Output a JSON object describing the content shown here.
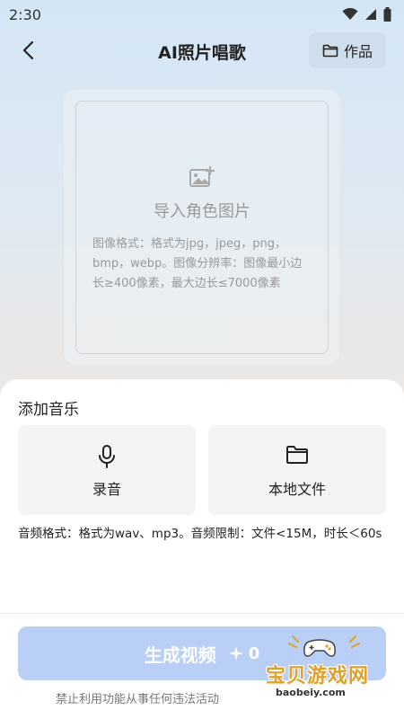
{
  "status_bar": {
    "time": "2:30"
  },
  "header": {
    "title": "AI照片唱歌",
    "works_label": "作品"
  },
  "upload": {
    "title": "导入角色图片",
    "description": "图像格式：格式为jpg，jpeg，png，bmp，webp。图像分辨率：图像最小边长≥400像素，最大边长≤7000像素"
  },
  "music_sheet": {
    "title": "添加音乐",
    "options": [
      {
        "label": "录音",
        "icon": "microphone-icon"
      },
      {
        "label": "本地文件",
        "icon": "folder-icon"
      }
    ],
    "format_note": "音频格式：格式为wav、mp3。音频限制：文件<15M，时长＜60s"
  },
  "generate": {
    "label": "生成视频",
    "cost": "0",
    "cost_icon": "sparkle-icon"
  },
  "disclaimer": "禁止利用功能从事任何违法活动",
  "watermark": {
    "text": "宝贝游戏网",
    "url": "baobeiy.com"
  },
  "colors": {
    "generate_button": "#b9cff5",
    "works_button": "#cfdeed",
    "sheet_background": "#ffffff"
  }
}
